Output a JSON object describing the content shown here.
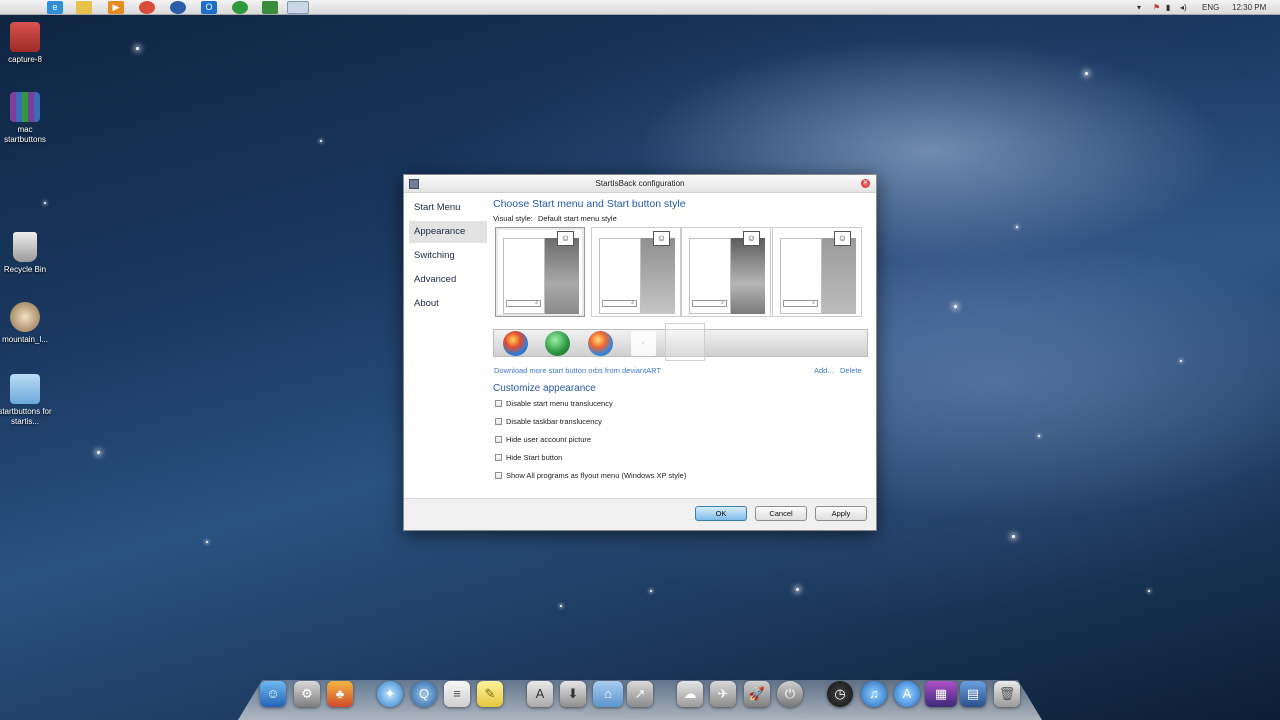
{
  "menubar": {
    "apple_glyph": "",
    "tray": {
      "language": "ENG",
      "time": "12:30 PM"
    }
  },
  "desktop_icons": [
    {
      "label": "capture-8",
      "icon": "image-file-icon",
      "color": "#c0392b"
    },
    {
      "label": "mac startbuttons",
      "icon": "archive-icon",
      "color": "#7b3f98"
    },
    {
      "label": "Recycle Bin",
      "icon": "trash-icon",
      "color": "#c7c7c7"
    },
    {
      "label": "mountain_l...",
      "icon": "image-file-icon",
      "color": "#b59570"
    },
    {
      "label": "startbuttons for startis...",
      "icon": "folder-icon",
      "color": "#8ec3ea"
    }
  ],
  "dialog": {
    "title": "StartIsBack configuration",
    "sidebar": [
      "Start Menu",
      "Appearance",
      "Switching",
      "Advanced",
      "About"
    ],
    "active_index": 1,
    "heading": "Choose Start menu and Start button style",
    "visual_style_label": "Visual style:",
    "visual_style_value": "Default start menu style",
    "orbs_link": "Download more start button orbs from deviantART",
    "add_link": "Add...",
    "delete_link": "Delete",
    "customize_heading": "Customize appearance",
    "options": [
      {
        "label": "Disable start menu translucency",
        "checked": false
      },
      {
        "label": "Disable taskbar translucency",
        "checked": false
      },
      {
        "label": "Hide user account picture",
        "checked": false
      },
      {
        "label": "Hide Start button",
        "checked": false
      },
      {
        "label": "Show All programs as flyout menu (Windows XP style)",
        "checked": false
      }
    ],
    "buttons": {
      "ok": "OK",
      "cancel": "Cancel",
      "apply": "Apply"
    }
  }
}
